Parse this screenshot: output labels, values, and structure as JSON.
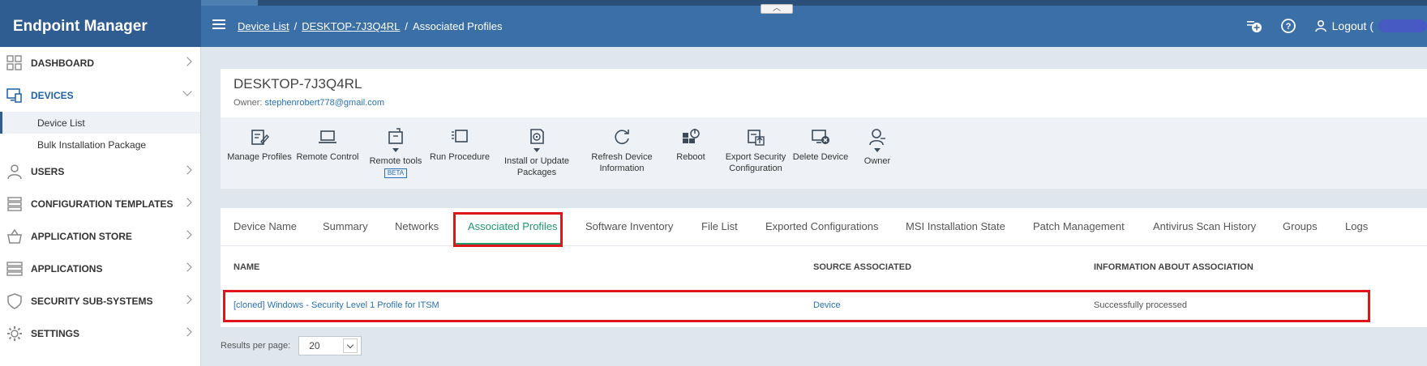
{
  "app": {
    "title": "Endpoint Manager"
  },
  "breadcrumb": {
    "items": [
      "Device List",
      "DESKTOP-7J3Q4RL",
      "Associated Profiles"
    ],
    "separator": "/"
  },
  "header": {
    "logout_label": "Logout ("
  },
  "sidebar": {
    "items": [
      {
        "label": "DASHBOARD",
        "icon": "dashboard-grid-icon"
      },
      {
        "label": "DEVICES",
        "icon": "devices-icon",
        "expanded": true
      },
      {
        "label": "USERS",
        "icon": "user-icon"
      },
      {
        "label": "CONFIGURATION TEMPLATES",
        "icon": "stack-icon"
      },
      {
        "label": "APPLICATION STORE",
        "icon": "basket-icon"
      },
      {
        "label": "APPLICATIONS",
        "icon": "applications-icon"
      },
      {
        "label": "SECURITY SUB-SYSTEMS",
        "icon": "shield-icon"
      },
      {
        "label": "SETTINGS",
        "icon": "gear-icon"
      }
    ],
    "device_subitems": [
      "Device List",
      "Bulk Installation Package"
    ]
  },
  "device": {
    "name": "DESKTOP-7J3Q4RL",
    "owner_label": "Owner:",
    "owner_email": "stephenrobert778@gmail.com"
  },
  "toolbar": {
    "manage_profiles": "Manage Profiles",
    "remote_control": "Remote Control",
    "remote_tools": "Remote tools",
    "beta": "BETA",
    "run_procedure": "Run Procedure",
    "install_1": "Install or Update",
    "install_2": "Packages",
    "refresh_1": "Refresh Device",
    "refresh_2": "Information",
    "reboot": "Reboot",
    "export_1": "Export Security",
    "export_2": "Configuration",
    "delete_device": "Delete Device",
    "owner": "Owner"
  },
  "tabs": [
    "Device Name",
    "Summary",
    "Networks",
    "Associated Profiles",
    "Software Inventory",
    "File List",
    "Exported Configurations",
    "MSI Installation State",
    "Patch Management",
    "Antivirus Scan History",
    "Groups",
    "Logs"
  ],
  "table": {
    "headers": [
      "NAME",
      "SOURCE ASSOCIATED",
      "INFORMATION ABOUT ASSOCIATION"
    ],
    "rows": [
      [
        "[cloned] Windows - Security Level 1 Profile for ITSM",
        "Device",
        "Successfully processed"
      ]
    ]
  },
  "pagination": {
    "label": "Results per page:",
    "value": "20"
  },
  "colors": {
    "header": "#3b6fa8",
    "brand": "#2f5d91",
    "active_tab": "#1f9a6c",
    "highlight": "#e0151c",
    "link": "#2a72b8"
  }
}
